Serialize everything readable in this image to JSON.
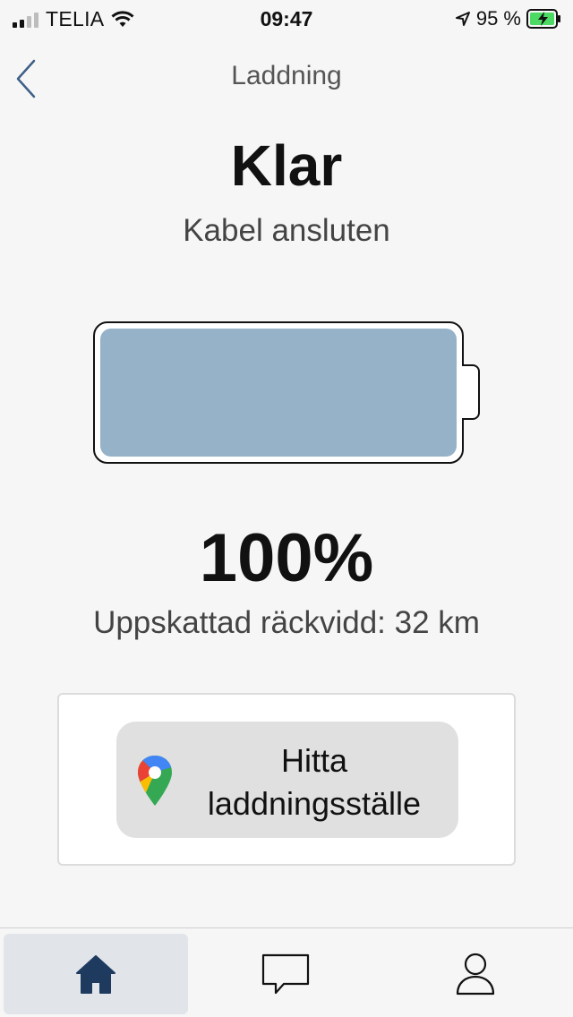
{
  "status_bar": {
    "carrier": "TELIA",
    "time": "09:47",
    "battery_percent": "95 %"
  },
  "nav": {
    "title": "Laddning",
    "back_icon": "chevron-left-icon"
  },
  "charging": {
    "status": "Klar",
    "cable_status": "Kabel ansluten",
    "battery_level": 1.0,
    "battery_fill_color": "#95b2c8",
    "percent_label": "100%",
    "range_label": "Uppskattad räckvidd: 32 km"
  },
  "card": {
    "button_label_line1": "Hitta",
    "button_label_line2": "laddningsställe",
    "button_icon": "google-maps-pin-icon"
  },
  "tab_bar": {
    "items": [
      {
        "icon": "home-icon",
        "active": true
      },
      {
        "icon": "chat-icon",
        "active": false
      },
      {
        "icon": "profile-icon",
        "active": false
      }
    ],
    "active_color": "#1e3a5f"
  }
}
